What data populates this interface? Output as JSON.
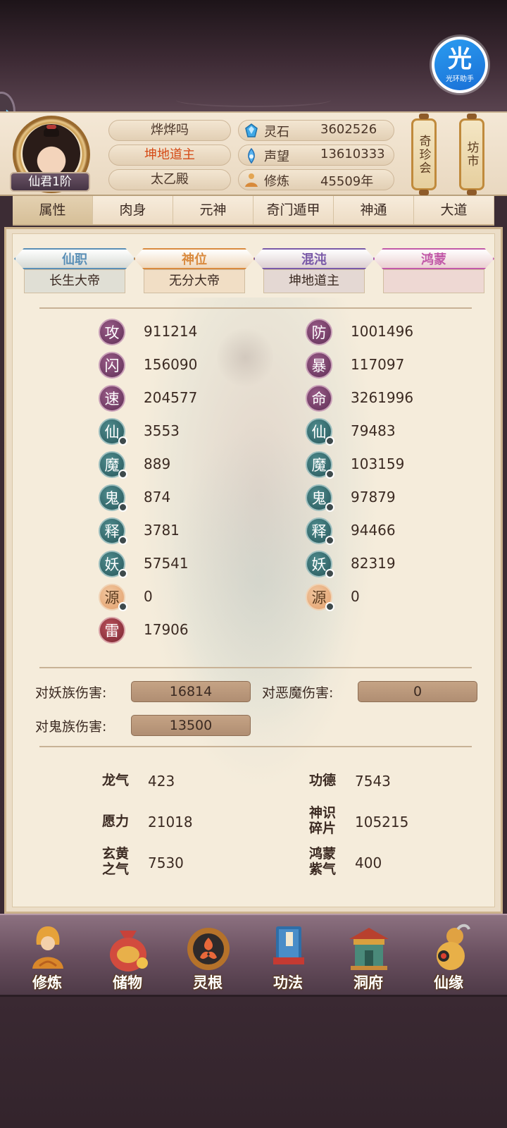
{
  "helper": {
    "big": "光",
    "small": "光环助手"
  },
  "player": {
    "name": "烨烨吗",
    "title": "坤地道主",
    "sect": "太乙殿",
    "rank": "仙君1阶"
  },
  "resources": [
    {
      "icon": "spirit-stone-icon",
      "label": "灵石",
      "value": "3602526"
    },
    {
      "icon": "prestige-icon",
      "label": "声望",
      "value": "13610333"
    },
    {
      "icon": "cultivation-icon",
      "label": "修炼",
      "value": "45509年"
    }
  ],
  "side_buttons": {
    "treasure": "奇珍会",
    "market": "坊市"
  },
  "tabs": [
    "属性",
    "肉身",
    "元神",
    "奇门遁甲",
    "神通",
    "大道"
  ],
  "active_tab": "属性",
  "ranks": [
    {
      "head": "仙职",
      "value": "长生大帝",
      "color": "#5a8fb6"
    },
    {
      "head": "神位",
      "value": "无分大帝",
      "color": "#d98a3e"
    },
    {
      "head": "混沌",
      "value": "坤地道主",
      "color": "#7a5aa8"
    },
    {
      "head": "鸿蒙",
      "value": "",
      "color": "#c25aa8"
    }
  ],
  "stats_left": [
    {
      "icon": "攻",
      "value": "911214",
      "style": "purple"
    },
    {
      "icon": "闪",
      "value": "156090",
      "style": "purple"
    },
    {
      "icon": "速",
      "value": "204577",
      "style": "purple"
    },
    {
      "icon": "仙",
      "value": "3553",
      "style": "teal"
    },
    {
      "icon": "魔",
      "value": "889",
      "style": "teal"
    },
    {
      "icon": "鬼",
      "value": "874",
      "style": "teal"
    },
    {
      "icon": "释",
      "value": "3781",
      "style": "teal"
    },
    {
      "icon": "妖",
      "value": "57541",
      "style": "teal"
    },
    {
      "icon": "源",
      "value": "0",
      "style": "orange"
    },
    {
      "icon": "雷",
      "value": "17906",
      "style": "red"
    }
  ],
  "stats_right": [
    {
      "icon": "防",
      "value": "1001496",
      "style": "purple"
    },
    {
      "icon": "暴",
      "value": "117097",
      "style": "purple"
    },
    {
      "icon": "命",
      "value": "3261996",
      "style": "purple"
    },
    {
      "icon": "仙",
      "value": "79483",
      "style": "teal"
    },
    {
      "icon": "魔",
      "value": "103159",
      "style": "teal"
    },
    {
      "icon": "鬼",
      "value": "97879",
      "style": "teal"
    },
    {
      "icon": "释",
      "value": "94466",
      "style": "teal"
    },
    {
      "icon": "妖",
      "value": "82319",
      "style": "teal"
    },
    {
      "icon": "源",
      "value": "0",
      "style": "orange"
    }
  ],
  "damage": [
    {
      "label": "对妖族伤害:",
      "value": "16814"
    },
    {
      "label": "对恶魔伤害:",
      "value": "0"
    },
    {
      "label": "对鬼族伤害:",
      "value": "13500"
    }
  ],
  "extras": [
    {
      "label": "龙气",
      "value": "423"
    },
    {
      "label": "功德",
      "value": "7543"
    },
    {
      "label": "愿力",
      "value": "21018"
    },
    {
      "label": "神识碎片",
      "value": "105215"
    },
    {
      "label": "玄黄之气",
      "value": "7530"
    },
    {
      "label": "鸿蒙紫气",
      "value": "400"
    }
  ],
  "nav": [
    "修炼",
    "储物",
    "灵根",
    "功法",
    "洞府",
    "仙缘"
  ]
}
